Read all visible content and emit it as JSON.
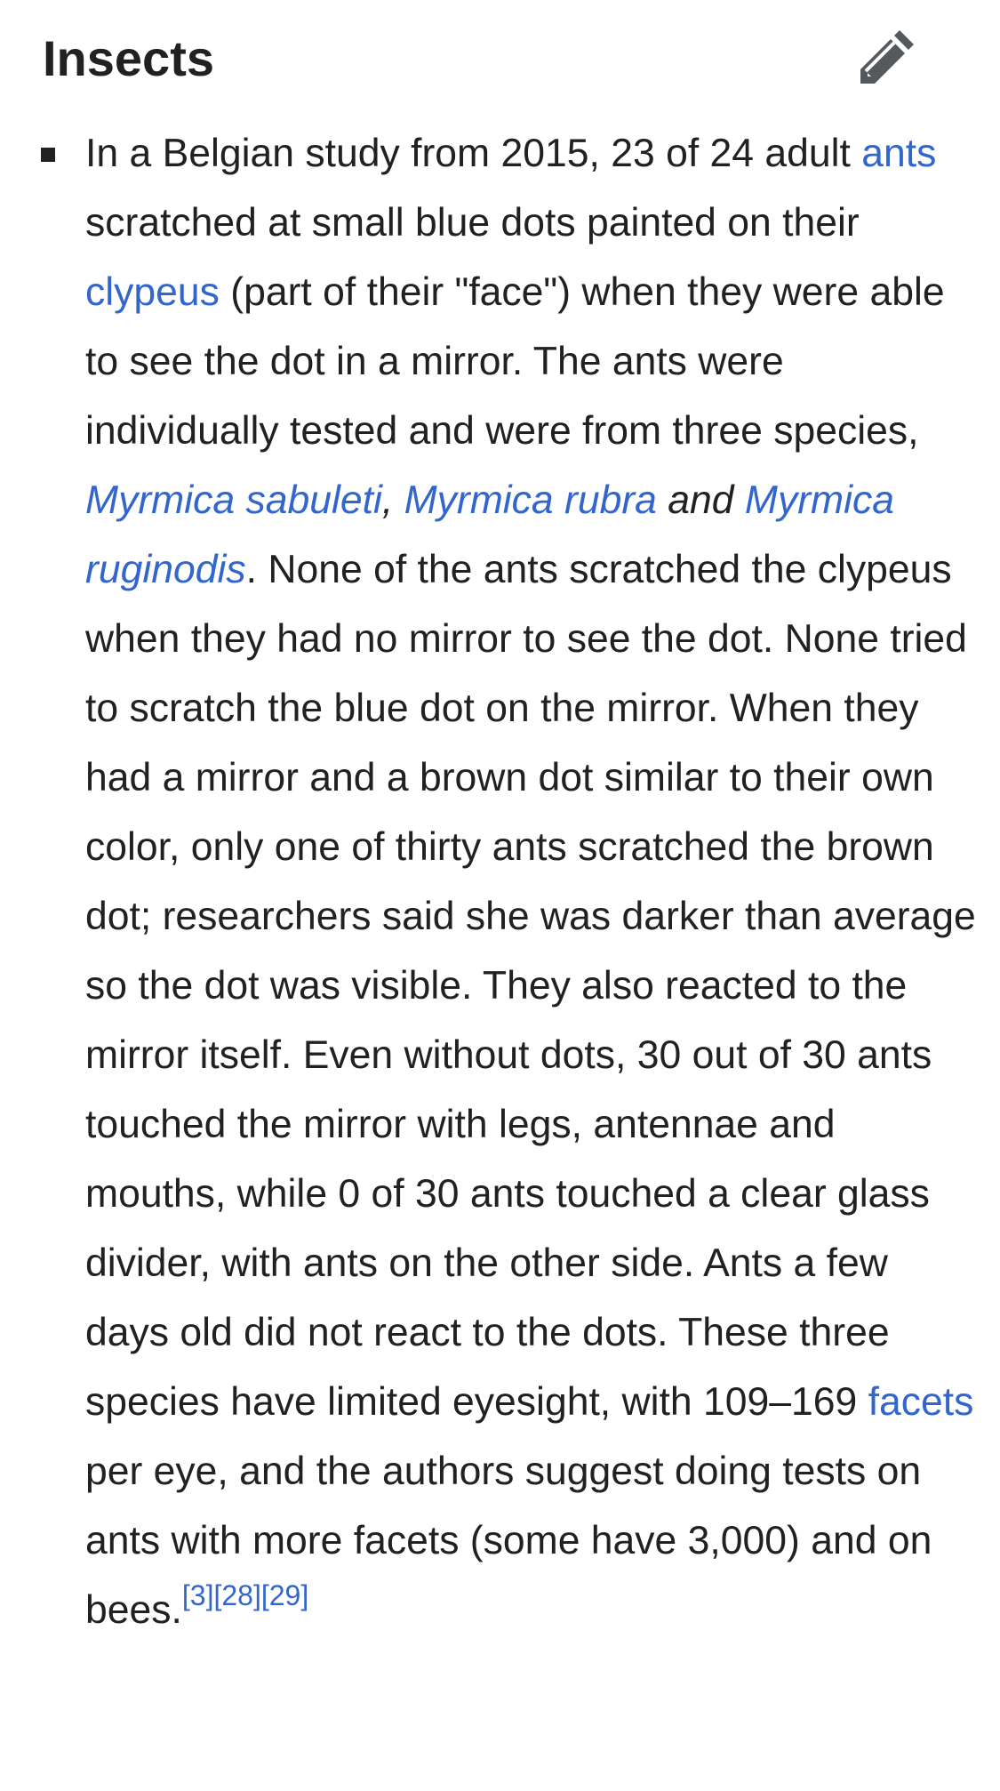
{
  "section": {
    "title": "Insects",
    "edit_icon": "pencil-icon"
  },
  "item": {
    "t1": "In a Belgian study from 2015, 23 of 24 adult ",
    "link_ants": "ants",
    "t2": " scratched at small blue dots painted on their ",
    "link_clypeus": "clypeus",
    "t3": " (part of their \"face\") when they were able to see the dot in a mirror. The ants were individually tested and were from three species, ",
    "link_sabuleti": "Myrmica sabuleti",
    "t4": ", ",
    "link_rubra": "Myrmica rubra",
    "t5": " and ",
    "link_ruginodis": "Myrmica ruginodis",
    "t6": ". None of the ants scratched the clypeus when they had no mirror to see the dot. None tried to scratch the blue dot on the mirror. When they had a mirror and a brown dot similar to their own color, only one of thirty ants scratched the brown dot; researchers said she was darker than average so the dot was visible. They also reacted to the mirror itself. Even without dots, 30 out of 30 ants touched the mirror with legs, antennae and mouths, while 0 of 30 ants touched a clear glass divider, with ants on the other side. Ants a few days old did not react to the dots. These three species have limited eyesight, with 109–169 ",
    "link_facets": "facets",
    "t7": " per eye, and the authors suggest doing tests on ants with more facets (some have 3,000) and on bees.",
    "refs": [
      "[3]",
      "[28]",
      "[29]"
    ]
  },
  "colors": {
    "text": "#202122",
    "link": "#3366cc"
  }
}
